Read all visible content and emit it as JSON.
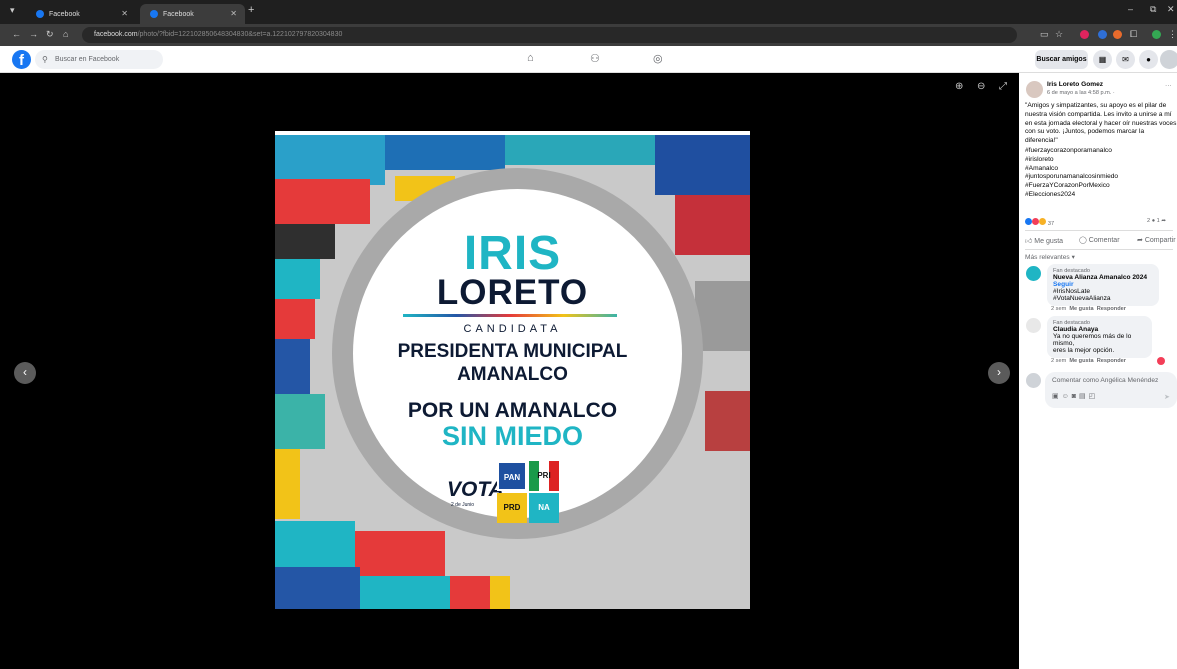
{
  "browser": {
    "tabs": [
      {
        "title": "Facebook"
      },
      {
        "title": "Facebook"
      }
    ],
    "new_tab": "+",
    "url_host": "facebook.com",
    "url_rest": "/photo/?fbid=122102850648304830&set=a.122102797820304830"
  },
  "fb": {
    "logo": "f",
    "search_placeholder": "Buscar en Facebook",
    "buscar_amigos": "Buscar amigos"
  },
  "photo": {
    "name1": "IRIS",
    "name2": "LORETO",
    "role": "CANDIDATA",
    "office1": "PRESIDENTA MUNICIPAL",
    "office2": "AMANALCO",
    "slogan1": "POR UN AMANALCO",
    "slogan2": "SIN MIEDO",
    "vota": "VOTA",
    "vota_date": "2 de Junio",
    "logos": [
      "PAN",
      "PRI",
      "PRD",
      "NA"
    ]
  },
  "post": {
    "author": "Iris Loreto Gomez",
    "date": "6 de mayo a las 4:58 p.m. ·",
    "body": "\"Amigos y simpatizantes, su apoyo es el pilar de nuestra visión compartida. Les invito a unirse a mí en esta jornada electoral y hacer oír nuestras voces con su voto. ¡Juntos, podemos marcar la diferencia!\"",
    "hashtags": [
      "#fuerzaycorazonporamanalco",
      "#irisloreto",
      "#Amanalco",
      "#juntosporunamanalcosinmiedo",
      "#FuerzaYCorazonPorMexico",
      "#Elecciones2024"
    ],
    "reaction_count": "37",
    "comment_count": "2",
    "share_count": "1",
    "actions": [
      "Me gusta",
      "Comentar",
      "Compartir"
    ],
    "sort": "Más relevantes",
    "more": "···"
  },
  "comments": [
    {
      "badge": "Fan destacado",
      "author": "Nueva Alianza Amanalco 2024",
      "follow": "Seguir",
      "lines": [
        "#IrisNosLate",
        "#VotaNuevaAlianza"
      ],
      "time": "2 sem",
      "like": "Me gusta",
      "reply": "Responder"
    },
    {
      "badge": "Fan destacado",
      "author": "Claudia Anaya",
      "lines": [
        "Ya no queremos más de lo mismo,",
        "eres la mejor opción."
      ],
      "time": "2 sem",
      "like": "Me gusta",
      "reply": "Responder"
    }
  ],
  "composer": {
    "placeholder": "Comentar como Angélica Menéndez"
  },
  "colors": {
    "fb_blue": "#1877f2",
    "teal": "#1fb5c4",
    "navy": "#0d1a33"
  }
}
